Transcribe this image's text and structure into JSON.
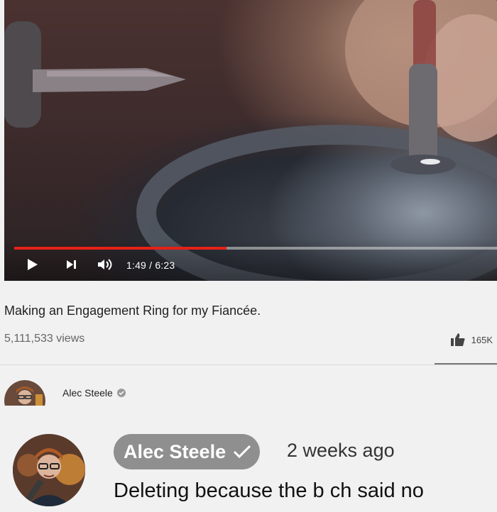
{
  "player": {
    "current_time": "1:49",
    "duration": "6:23",
    "time_display": "1:49 / 6:23",
    "progress": 0.44,
    "progress_color": "#e62117",
    "icons": {
      "play": "play-icon",
      "next": "next-icon",
      "volume": "volume-icon"
    }
  },
  "video": {
    "title": "Making an Engagement Ring for my Fiancée.",
    "views": "5,111,533 views",
    "likes": "165K",
    "like_icon": "thumbs-up-icon"
  },
  "channel": {
    "name": "Alec Steele",
    "verified_icon": "verified-check-icon"
  },
  "comment": {
    "author": "Alec Steele",
    "verified_icon": "check-icon",
    "timestamp": "2 weeks ago",
    "text": "Deleting because the b  ch said no",
    "pill_color": "#8f8f8f"
  }
}
